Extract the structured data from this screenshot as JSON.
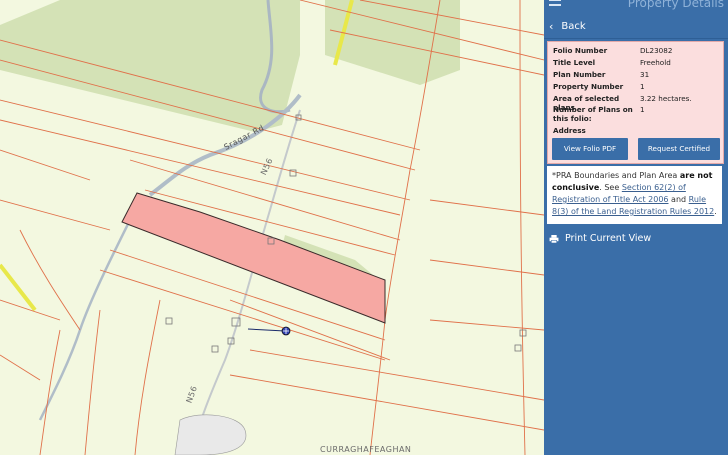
{
  "map": {
    "road_label_1": "Sragar Rd",
    "road_label_2": "N56",
    "road_label_3": "N56",
    "townland_label": "CURRAGHAFEAGHAN",
    "colors": {
      "background": "#f3f8e0",
      "parcel_lines": "#e0714a",
      "selected_parcel": "#f6a8a3",
      "woodland": "#d2e0b3",
      "road_yellow": "#e8e84a",
      "river": "#aab7c2"
    }
  },
  "panel": {
    "title": "Property Details",
    "back_label": "Back",
    "fields": [
      {
        "key": "Folio Number",
        "value": "DL23082"
      },
      {
        "key": "Title Level",
        "value": "Freehold"
      },
      {
        "key": "Plan Number",
        "value": "31"
      },
      {
        "key": "Property Number",
        "value": "1"
      },
      {
        "key": "Area of selected plans",
        "value": "3.22 hectares."
      },
      {
        "key": "Number of Plans on this folio:",
        "value": "1"
      },
      {
        "key": "Address",
        "value": ""
      }
    ],
    "view_pdf_label": "View Folio PDF",
    "request_copy_label": "Request Certified Copy",
    "notice": {
      "prefix": "*PRA Boundaries and Plan Area ",
      "bold": "are not conclusive",
      "see": ". See ",
      "link1": "Section 62(2) of Registration of Title Act 2006",
      "and": " and ",
      "link2": "Rule 8(3) of the Land Registration Rules 2012",
      "end": "."
    },
    "print_label": "Print Current View",
    "colors": {
      "panel_bg": "#3a6ea8",
      "info_bg": "#fbdede"
    }
  }
}
